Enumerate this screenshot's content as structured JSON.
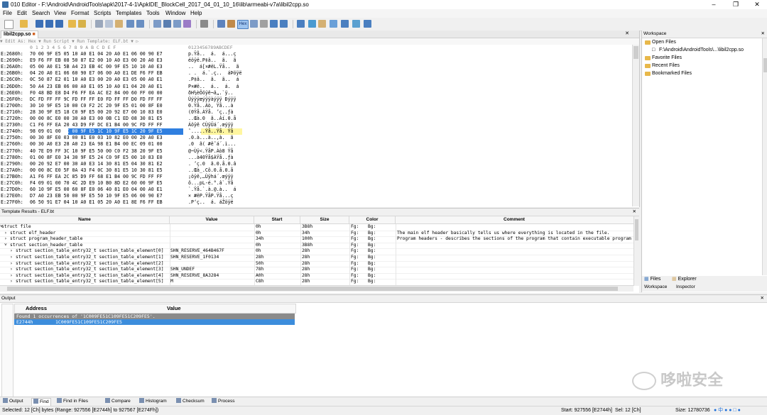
{
  "window": {
    "title": "010 Editor - F:\\Android\\AndroidTools\\apk\\2017-4-1\\ApkIDE_BlockCell_2017_04_01_10_16\\lib\\armeabi-v7a\\libil2cpp.so"
  },
  "menu": [
    "File",
    "Edit",
    "Search",
    "View",
    "Format",
    "Scripts",
    "Templates",
    "Tools",
    "Window",
    "Help"
  ],
  "editor": {
    "tab_label": "libil2cpp.so",
    "subbar": "▼  Edit As: Hex ▼    Run Script ▼    Run Template: ELF.bt ▼   ▷",
    "column_header": "  0  1  2  3  4  5  6  7  8  9  A  B  C  D  E  F",
    "ascii_header": "0123456789ABCDEF",
    "rows": [
      {
        "addr": "E:2680h:",
        "hex": "70 00 9F E5 05 10 A0 E1 04 20 A0 E1 06 00 90 E7",
        "asc": "p.Ÿå..  á.  á...ç"
      },
      {
        "addr": "E:2690h:",
        "hex": "E9 F6 FF EB 08 50 87 E2 00 10 A0 E3 00 20 A0 E3",
        "asc": "éöÿë.P‡â..  ã.  ã"
      },
      {
        "addr": "E:26A0h:",
        "hex": "05 00 A0 E1 5B A4 23 EB 4C 00 9F E5 10 10 A0 E3",
        "asc": "..  á[¤#ëL.Ÿå..  ã"
      },
      {
        "addr": "E:26B0h:",
        "hex": "04 20 A0 E1 06 60 90 E7 06 00 A0 E1 DE F6 FF EB",
        "asc": ". .  á.`.ç..  áÞöÿë"
      },
      {
        "addr": "E:26C0h:",
        "hex": "0C 50 87 E2 01 10 A0 E3 00 20 A0 E3 05 00 A0 E1",
        "asc": ".P‡â..  ã.  ã..  á"
      },
      {
        "addr": "E:26D0h:",
        "hex": "50 A4 23 EB 06 00 A0 E1 05 10 A0 E1 04 20 A0 E1",
        "asc": "P¤#ë..  á..  á.  á"
      },
      {
        "addr": "E:26E0h:",
        "hex": "F0 48 BD E8 D4 F6 FF EA AC E2 84 00 60 FF 00 00",
        "asc": "ðH½èÔöÿê¬â„.`ÿ.."
      },
      {
        "addr": "E:26F0h:",
        "hex": "DC FD FF FF 9C FD FF FF E0 FD FF FF D0 FD FF FF",
        "asc": "Üýÿÿœýÿÿàýÿÿ Ðýÿÿ"
      },
      {
        "addr": "E:2700h:",
        "hex": "30 10 9F E5 10 00 C0 F2 2C 20 9F E5 01 00 8F E0",
        "asc": "0.Ÿå..Àò, Ÿå...à"
      },
      {
        "addr": "E:2710h:",
        "hex": "28 30 9F E5 18 C0 9F E5 00 20 92 E7 00 10 83 E0",
        "asc": "(0Ÿå.ÀŸå. ’ç..ƒà"
      },
      {
        "addr": "E:2720h:",
        "hex": "00 00 8C E0 00 30 A0 E3 00 0B C1 ED 08 30 81 E5",
        "asc": "..Œà.0  ã..Áí.0.å"
      },
      {
        "addr": "E:2730h:",
        "hex": "C1 F6 FF EA 20 43 D9 FF DC E1 B4 00 9C FD FF FF",
        "asc": "Áöÿê CÙÿÜá´.œýÿÿ"
      },
      {
        "addr": "E:2740h:",
        "hex": "98 09 01 00 1C 00 9F E5 1C 10 9F E5 1C 20 9F E5",
        "asc": "˜.....Ÿå..Ÿå. Ÿå"
      },
      {
        "addr": "E:2750h:",
        "hex": "00 30 8F E0 03 00 81 E0 03 10 82 E0 00 20 A0 E3",
        "asc": ".0.à...à..‚à.  ã"
      },
      {
        "addr": "E:2760h:",
        "hex": "00 30 A0 E3 28 A0 23 EA 98 E1 B4 00 EC 09 01 00",
        "asc": ".0  ã( #ê˜á´.ì..."
      },
      {
        "addr": "E:2770h:",
        "hex": "40 7E D9 FF 3C 10 9F E5 50 00 C0 F2 38 20 9F E5",
        "asc": "@~Ùÿ<.ŸåP.Àò8 Ÿå"
      },
      {
        "addr": "E:2780h:",
        "hex": "01 00 8F E0 34 30 9F E5 24 C0 9F E5 00 10 83 E0",
        "asc": "...à40Ÿå$ÀŸå..ƒà"
      },
      {
        "addr": "E:2790h:",
        "hex": "00 20 92 E7 00 30 A0 E3 14 30 81 E5 04 30 81 E2",
        "asc": ". ’ç.0  ã.0.å.0.â"
      },
      {
        "addr": "E:27A0h:",
        "hex": "00 00 8C E0 5F 0A 43 F4 0C 30 81 E5 10 30 81 E5",
        "asc": "..Œà_.Cô.0.å.0.å"
      },
      {
        "addr": "E:27B0h:",
        "hex": "A1 F6 FF EA 2C 85 D9 FF 68 E1 B4 00 9C FD FF FF",
        "asc": "¡öÿê,…Ùÿhá´.œýÿÿ"
      },
      {
        "addr": "E:27C0h:",
        "hex": "F4 09 01 00 70 4C 2D E9 10 B0 8D E2 60 00 9F E5",
        "asc": "ô...pL-é.°.â`.Ÿå"
      },
      {
        "addr": "E:27D0h:",
        "hex": "60 10 9F E5 00 60 8F E0 06 40 81 E0 04 00 A0 E1",
        "asc": "`.Ÿå.`.à.@.à..  á"
      },
      {
        "addr": "E:27E0h:",
        "hex": "D7 A0 23 EB 50 00 9F E5 50 10 9F E5 06 00 90 E7",
        "asc": "× #ëP.ŸåP.Ÿå...ç"
      },
      {
        "addr": "E:27F0h:",
        "hex": "06 50 91 E7 04 10 A0 E1 05 20 A0 E1 8E F6 FF EB",
        "asc": ".P‘ç..  á. áŽöÿë"
      }
    ]
  },
  "template": {
    "title": "Template Results - ELF.bt",
    "columns": [
      "Name",
      "Value",
      "Start",
      "Size",
      "Color",
      "Comment"
    ],
    "rows": [
      {
        "name": "struct file",
        "value": "",
        "start": "0h",
        "size": "3B8h",
        "fg": "Fg:",
        "bg": "Bg:",
        "comment": ""
      },
      {
        "name": "struct elf_header",
        "value": "",
        "start": "0h",
        "size": "34h",
        "fg": "Fg:",
        "bg": "Bg:",
        "comment": "The main elf header basically tells us where everything is located in the file."
      },
      {
        "name": "struct program_header_table",
        "value": "",
        "start": "34h",
        "size": "100h",
        "fg": "Fg:",
        "bg": "Bg:",
        "comment": "Program headers - describes the sections of the program that contain executable program code whi..."
      },
      {
        "name": "struct section_header_table",
        "value": "",
        "start": "0h",
        "size": "3B8h",
        "fg": "Fg:",
        "bg": "Bg:",
        "comment": ""
      },
      {
        "name": "struct section_table_entry32_t section_table_element[0]",
        "value": "SHN_RESERVE_464B467F",
        "start": "0h",
        "size": "28h",
        "fg": "Fg:",
        "bg": "Bg:",
        "comment": ""
      },
      {
        "name": "struct section_table_entry32_t section_table_element[1]",
        "value": "SHN_RESERVE_1F0134",
        "start": "28h",
        "size": "28h",
        "fg": "Fg:",
        "bg": "Bg:",
        "comment": ""
      },
      {
        "name": "struct section_table_entry32_t section_table_element[2]",
        "value": "",
        "start": "50h",
        "size": "28h",
        "fg": "Fg:",
        "bg": "Bg:",
        "comment": ""
      },
      {
        "name": "struct section_table_entry32_t section_table_element[3]",
        "value": "SHN_UNDEF",
        "start": "78h",
        "size": "28h",
        "fg": "Fg:",
        "bg": "Bg:",
        "comment": ""
      },
      {
        "name": "struct section_table_entry32_t section_table_element[4]",
        "value": "SHN_RESERVE_8A3284",
        "start": "A0h",
        "size": "28h",
        "fg": "Fg:",
        "bg": "Bg:",
        "comment": ""
      },
      {
        "name": "struct section_table_entry32_t section_table_element[5]",
        "value": "M",
        "start": "C8h",
        "size": "28h",
        "fg": "Fg:",
        "bg": "Bg:",
        "comment": ""
      }
    ]
  },
  "workspace": {
    "title": "Workspace",
    "open_files": "Open Files",
    "file_path": "F:\\Android\\AndroidTools\\...\\libil2cpp.so",
    "favorite_files": "Favorite Files",
    "recent_files": "Recent Files",
    "bookmarked_files": "Bookmarked Files",
    "tab_files": "Files",
    "tab_explorer": "Explorer",
    "tab_workspace": "Workspace",
    "tab_inspector": "Inspector"
  },
  "output": {
    "title": "Output",
    "columns": [
      "Address",
      "Value"
    ],
    "found_text": "Found 1 occurrences of '1C009FE51C109FE51C209FE5'.",
    "result_addr": "E2744h",
    "result_value": "1C009FE51C109FE51C209FE5"
  },
  "bottom_tabs": [
    "Output",
    "Find",
    "Find in Files",
    "Compare",
    "Histogram",
    "Checksum",
    "Process"
  ],
  "status": {
    "selected": "Selected: 12 [Ch] bytes (Range: 927556 [E2744h] to 927567 [E274Fh])",
    "start": "Start: 927556 [E2744h]",
    "sel": "Sel: 12 [Ch]",
    "size": "Size: 12780736"
  },
  "watermark": "哆啦安全",
  "colors": {
    "selection": "#2f7fe0",
    "selection_ascii": "#fff6a0",
    "output_selected": "#3c8ddc",
    "found_row": "#8a8a8a"
  }
}
